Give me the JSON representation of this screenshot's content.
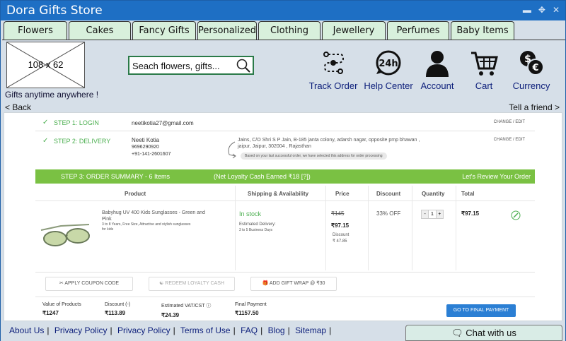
{
  "window": {
    "title": "Dora Gifts Store"
  },
  "tabs": [
    "Flowers",
    "Cakes",
    "Fancy Gifts",
    "Personalized",
    "Clothing",
    "Jewellery",
    "Perfumes",
    "Baby Items"
  ],
  "header": {
    "logo_placeholder": "108 x 62",
    "tagline": "Gifts anytime anywhere !",
    "search_placeholder": "Seach flowers, gifts...",
    "icons": [
      {
        "label": "Track Order",
        "icon": "track-order-icon"
      },
      {
        "label": "Help Center",
        "icon": "help-center-icon"
      },
      {
        "label": "Account",
        "icon": "account-icon"
      },
      {
        "label": "Cart",
        "icon": "cart-icon"
      },
      {
        "label": "Currency",
        "icon": "currency-icon"
      }
    ]
  },
  "nav": {
    "back": "< Back",
    "tell": "Tell a friend >"
  },
  "checkout": {
    "step1": {
      "name": "STEP 1: LOGIN",
      "email": "neetikotia27@gmail.com",
      "edit": "CHANGE / EDIT"
    },
    "step2": {
      "name": "STEP 2: DELIVERY",
      "person": "Neeti Kotia",
      "phone1": "9696290920",
      "phone2": "+91-141-2601607",
      "address_line1": "Jains, C/O Shri S P Jain, B-185 janta colony, adarsh nagar, opposite pmp bhawan ,",
      "address_line2": "jaipur, Jaipur, 302004 , Rajasthan",
      "address_note": "Based on your last successful order, we have selected this address for order processing",
      "edit": "CHANGE / EDIT"
    },
    "summary": {
      "title": "STEP 3: ORDER SUMMARY - 6 Items",
      "loyalty": "(Net Loyalty Cash Earned ₹18 [?])",
      "review": "Let's Review Your Order"
    },
    "table_headers": [
      "Product",
      "Shipping & Availability",
      "Price",
      "Discount",
      "Quantity",
      "Total"
    ],
    "item": {
      "name_line1": "Babyhug UV 400 Kids Sunglasses - Green and",
      "name_line2": "Pink",
      "desc_line1": "3 to 8 Years, Free Size, Attractive and stylish sunglasses",
      "desc_line2": "for kids",
      "stock": "In stock",
      "delivery_label": "Estimated Delivery:",
      "delivery_value": "3 to 5 Business Days",
      "price_old": "₹145",
      "price_new": "₹97.15",
      "discount_label": "Discount",
      "discount_amount": "₹ 47.85",
      "discount_pct": "33% OFF",
      "qty_minus": "-",
      "qty": "1",
      "qty_plus": "+",
      "total": "₹97.15"
    },
    "actions": {
      "coupon": "APPLY COUPON CODE",
      "loyalty": "REDEEM LOYALTY CASH",
      "giftwrap": "ADD GIFT WRAP @ ₹30"
    },
    "totals": [
      {
        "label": "Value of Products",
        "value": "₹1247"
      },
      {
        "label": "Discount (-)",
        "value": "₹113.89"
      },
      {
        "label": "Estimated VAT/CST ⓘ",
        "value": "₹24.39"
      },
      {
        "label": "Final Payment",
        "value": "₹1157.50"
      }
    ],
    "final_button": "GO TO FINAL PAYMENT"
  },
  "footer": {
    "links": [
      "About Us",
      "Privacy Policy",
      "Privacy Policy",
      "Terms of Use",
      "FAQ",
      "Blog",
      "Sitemap"
    ],
    "chat": "Chat with us"
  },
  "colors": {
    "titlebar": "#1e6fc4",
    "tab": "#d8f0dc",
    "summary": "#7ac143",
    "button": "#2b7fd4"
  }
}
